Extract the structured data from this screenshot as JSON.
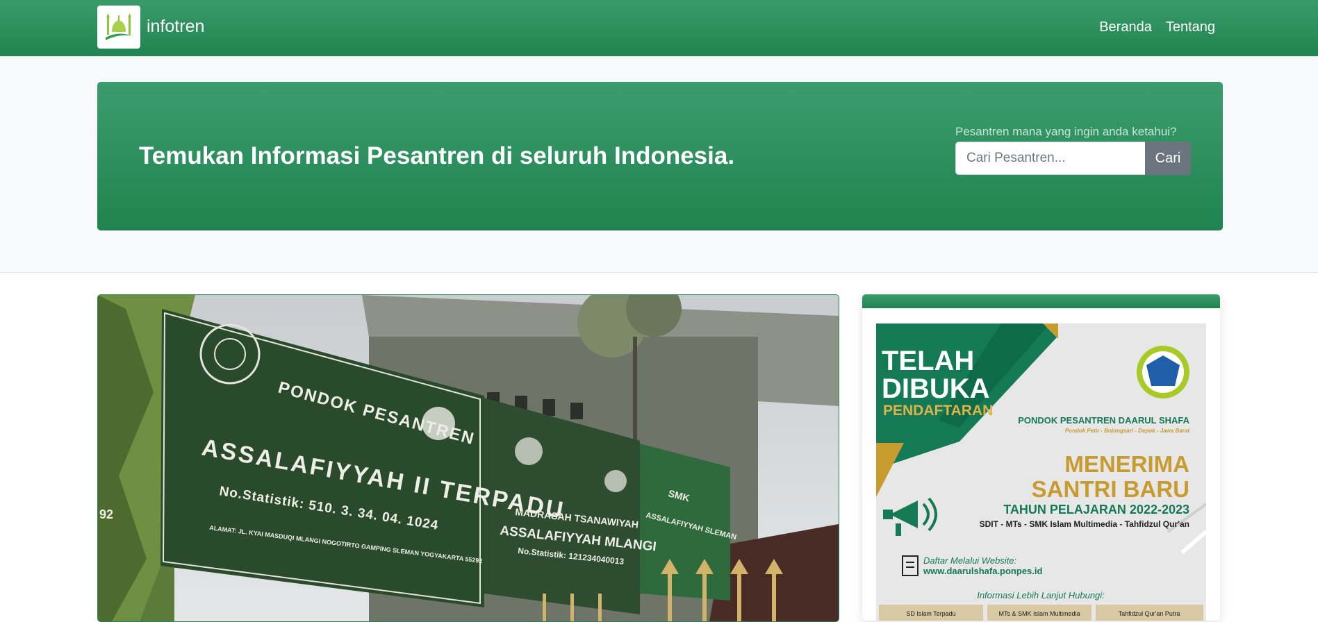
{
  "navbar": {
    "brand": "infotren",
    "links": [
      "Beranda",
      "Tentang"
    ]
  },
  "hero": {
    "title": "Temukan Informasi Pesantren di seluruh Indonesia.",
    "search_label": "Pesantren mana yang ingin anda ketahui?",
    "search_placeholder": "Cari Pesantren...",
    "search_button": "Cari"
  },
  "featured": {
    "sign_main_heading": "PONDOK PESANTREN",
    "sign_main_name": "ASSALAFIYYAH II TERPADU",
    "sign_main_stat": "No.Statistik: 510. 3. 34. 04. 1024",
    "sign_main_address": "ALAMAT: JL. KYAI MASDUQI MLANGI NOGOTIRTO GAMPING SLEMAN YOGYAKARTA 55292",
    "sign_mts_line1": "MADRASAH TSANAWIYAH",
    "sign_mts_line2": "ASSALAFIYYAH MLANGI",
    "sign_mts_stat": "No.Statistik: 121234040013",
    "sign_smk_line1": "SMK",
    "sign_smk_line2": "ASSALAFIYYAH SLEMAN",
    "side_number": "92"
  },
  "sidebar_ad": {
    "headline1": "TELAH",
    "headline2": "DIBUKA",
    "headline3": "PENDAFTARAN",
    "school": "PONDOK PESANTREN DAARUL SHAFA",
    "location": "Pondok Petir - Bojongsari - Depok - Jawa Barat",
    "menerima": "MENERIMA",
    "santri_baru": "SANTRI BARU",
    "tahun": "TAHUN PELAJARAN 2022-2023",
    "programs": "SDIT - MTs - SMK Islam Multimedia - Tahfidzul Qur'an",
    "daftar_label": "Daftar Melalui Website:",
    "website": "www.daarulshafa.ponpes.id",
    "info": "Informasi Lebih Lanjut Hubungi:",
    "contacts": [
      "SD Islam Terpadu",
      "MTs & SMK Islam Multimedia",
      "Tahfidzul Qur'an Putra"
    ]
  },
  "colors": {
    "primary": "#1f8450",
    "primary_light": "#3c9c6d",
    "gold": "#c79b2e",
    "button_gray": "#6c757d"
  }
}
